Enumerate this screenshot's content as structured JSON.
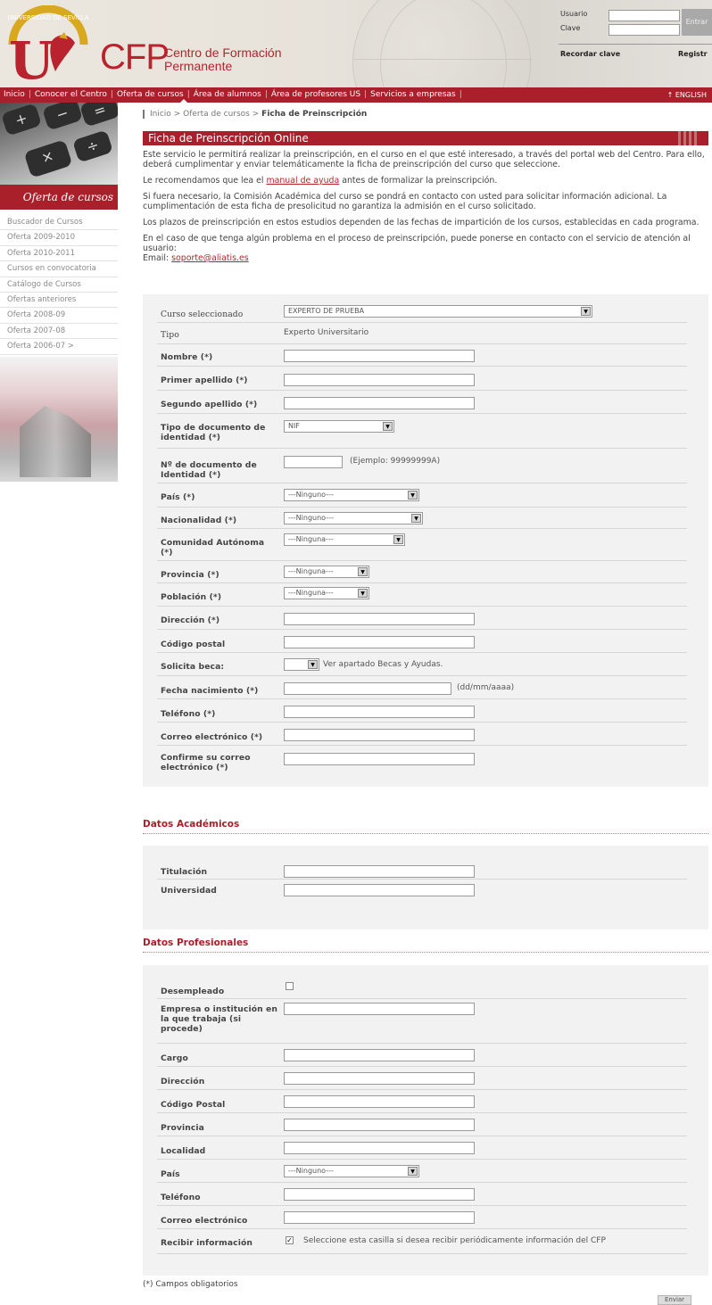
{
  "header": {
    "seal_text": "UNIVERSIDAD DE SEVILLA",
    "logo_cfp": "CFP",
    "logo_line1": "Centro de Formación",
    "logo_line2": "Permanente",
    "login": {
      "user_label": "Usuario",
      "pass_label": "Clave",
      "submit_label": "Entrar",
      "remember_label": "Recordar clave",
      "register_label": "Registr"
    }
  },
  "nav": {
    "items": [
      "Inicio",
      "Conocer el Centro",
      "Oferta de cursos",
      "Área de alumnos",
      "Área de profesores US",
      "Servicios a empresas"
    ],
    "english": "ENGLISH"
  },
  "sidebar": {
    "title": "Oferta de cursos",
    "items": [
      "Buscador de Cursos",
      "Oferta 2009-2010",
      "Oferta 2010-2011",
      "Cursos en convocatoria",
      "Catálogo de Cursos",
      "Ofertas anteriores",
      "Oferta 2008-09",
      "Oferta 2007-08",
      "Oferta 2006-07 >"
    ]
  },
  "breadcrumb": {
    "part1": "Inicio",
    "sep": ">",
    "part2": "Oferta de cursos",
    "current": "Ficha de Preinscripción"
  },
  "page_title": "Ficha de Preinscripción Online",
  "intro": {
    "p1": "Este servicio le permitirá realizar la preinscripción, en el curso en el que esté interesado, a través del portal web del Centro. Para ello, deberá cumplimentar y enviar telemáticamente la ficha de preinscripción del curso que seleccione.",
    "p2_before": "Le recomendamos que lea el ",
    "p2_link": "manual de ayuda",
    "p2_after": " antes de formalizar la preinscripción.",
    "p3": "Si fuera necesario, la Comisión Académica del curso se pondrá en contacto con usted para solicitar información adicional. La cumplimentación de esta ficha de presolicitud no garantiza la admisión en el curso solicitado.",
    "p4": "Los plazos de preinscripción en estos estudios dependen de las fechas de impartición de los cursos, establecidas en cada programa.",
    "p5": "En el caso de que tenga algún problema en el proceso de preinscripción, puede ponerse en contacto con el servicio de atención al usuario:",
    "email_label": "Email: ",
    "email": "soporte@aliatis.es"
  },
  "form_personal": {
    "curso_label": "Curso seleccionado",
    "curso_value": "EXPERTO DE PRUEBA",
    "tipo_label": "Tipo",
    "tipo_value": "Experto Universitario",
    "nombre_label": "Nombre (*)",
    "apellido1_label": "Primer apellido (*)",
    "apellido2_label": "Segundo apellido (*)",
    "tipo_doc_label": "Tipo de documento de identidad (*)",
    "tipo_doc_value": "NIF",
    "num_doc_label": "Nº de documento de Identidad (*)",
    "num_doc_hint": "(Ejemplo: 99999999A)",
    "pais_label": "País (*)",
    "pais_value": "---Ninguno---",
    "nacionalidad_label": "Nacionalidad (*)",
    "nacionalidad_value": "---Ninguno---",
    "comunidad_label": "Comunidad Autónoma (*)",
    "comunidad_value": "---Ninguna---",
    "provincia_label": "Provincia (*)",
    "provincia_value": "---Ninguna---",
    "poblacion_label": "Población (*)",
    "poblacion_value": "---Ninguna---",
    "direccion_label": "Dirección (*)",
    "cp_label": "Código postal",
    "beca_label": "Solicita beca:",
    "beca_value": "",
    "beca_hint": "Ver apartado Becas y Ayudas.",
    "fecha_label": "Fecha nacimiento (*)",
    "fecha_hint": "(dd/mm/aaaa)",
    "telefono_label": "Teléfono (*)",
    "correo_label": "Correo electrónico (*)",
    "confirm_label": "Confirme su correo electrónico (*)"
  },
  "academic": {
    "title": "Datos Académicos",
    "titulacion_label": "Titulación",
    "universidad_label": "Universidad"
  },
  "professional": {
    "title": "Datos Profesionales",
    "desempleado_label": "Desempleado",
    "desempleado_checked": false,
    "empresa_label": "Empresa o institución en la que trabaja (si procede)",
    "cargo_label": "Cargo",
    "direccion_label": "Dirección",
    "cp_label": "Código Postal",
    "provincia_label": "Provincia",
    "localidad_label": "Localidad",
    "pais_label": "País",
    "pais_value": "---Ninguno---",
    "telefono_label": "Teléfono",
    "correo_label": "Correo electrónico",
    "recibir_label": "Recibir información",
    "recibir_checked": true,
    "recibir_text": "Seleccione esta casilla si desea recibir periódicamente información del CFP"
  },
  "footnote": "(*) Campos obligatorios",
  "submit_label": "Enviar"
}
